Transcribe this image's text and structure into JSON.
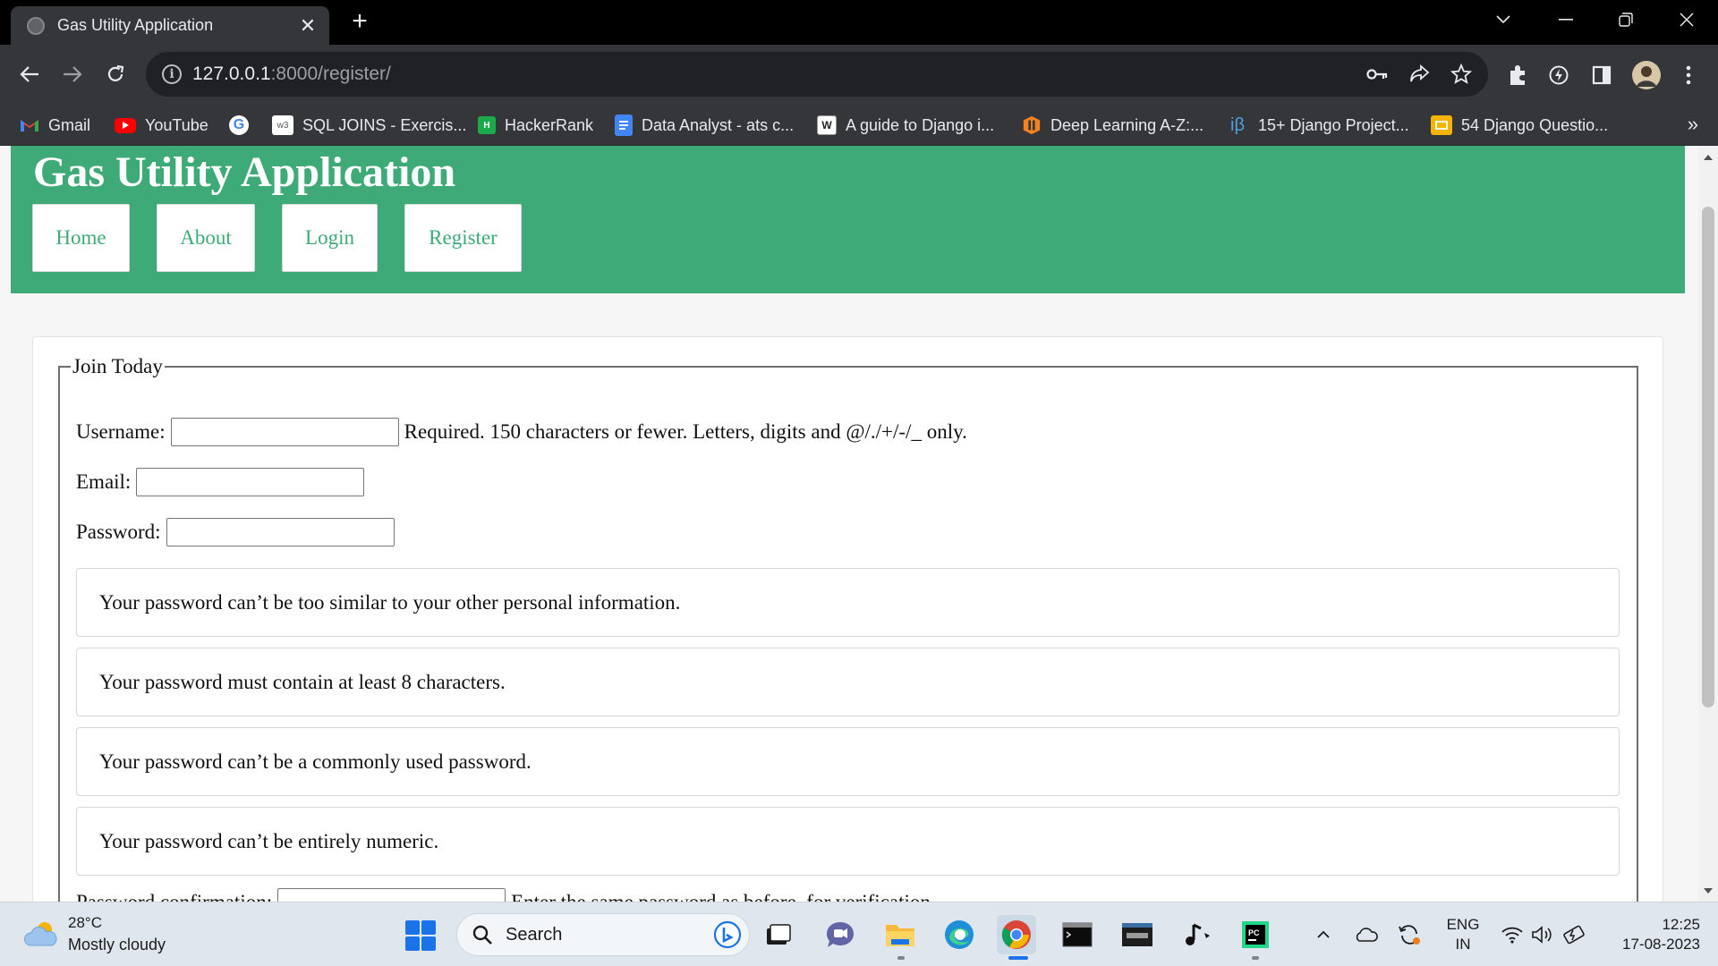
{
  "browser": {
    "tab": {
      "title": "Gas Utility Application",
      "close": "✕"
    },
    "new_tab": "+",
    "window_controls": {
      "tab_search": "⌄",
      "minimize": "—",
      "restore": "❐",
      "close": "✕"
    },
    "address": {
      "host": "127.0.0.1",
      "path": ":8000/register/"
    },
    "bookmarks": [
      {
        "label": "Gmail",
        "icon": "gmail-icon",
        "color": "#ea4335"
      },
      {
        "label": "YouTube",
        "icon": "youtube-icon",
        "color": "#ff0000"
      },
      {
        "label": "",
        "icon": "google-icon",
        "color": "#ffffff"
      },
      {
        "label": "SQL JOINS - Exercis...",
        "icon": "w3schools-icon",
        "color": "#ffffff"
      },
      {
        "label": "HackerRank",
        "icon": "hackerrank-icon",
        "color": "#1ba94c"
      },
      {
        "label": "Data Analyst - ats c...",
        "icon": "docs-icon",
        "color": "#4285f4"
      },
      {
        "label": "A guide to Django i...",
        "icon": "django-guide-icon",
        "color": "#ffffff"
      },
      {
        "label": "Deep Learning A-Z:...",
        "icon": "udemy-icon",
        "color": "#f5821f"
      },
      {
        "label": "15+ Django Project...",
        "icon": "ib-icon",
        "color": "#4aa3df"
      },
      {
        "label": "54 Django Questio...",
        "icon": "slides-icon",
        "color": "#f4b400"
      }
    ],
    "bookmarks_more": "»"
  },
  "site": {
    "title": "Gas Utility Application",
    "nav": [
      "Home",
      "About",
      "Login",
      "Register"
    ],
    "accent": "#3eaa78"
  },
  "form": {
    "legend": "Join Today",
    "username": {
      "label": "Username:",
      "value": "",
      "help": "Required. 150 characters or fewer. Letters, digits and @/./+/-/_ only."
    },
    "email": {
      "label": "Email:",
      "value": ""
    },
    "password": {
      "label": "Password:",
      "value": ""
    },
    "password_help": [
      "Your password can’t be too similar to your other personal information.",
      "Your password must contain at least 8 characters.",
      "Your password can’t be a commonly used password.",
      "Your password can’t be entirely numeric."
    ],
    "confirmation": {
      "label": "Password confirmation:",
      "help": "Enter the same password as before, for verification."
    }
  },
  "taskbar": {
    "weather": {
      "temp": "28°C",
      "desc": "Mostly cloudy"
    },
    "search_label": "Search",
    "language": {
      "line1": "ENG",
      "line2": "IN"
    },
    "clock": {
      "time": "12:25",
      "date": "17-08-2023"
    }
  }
}
